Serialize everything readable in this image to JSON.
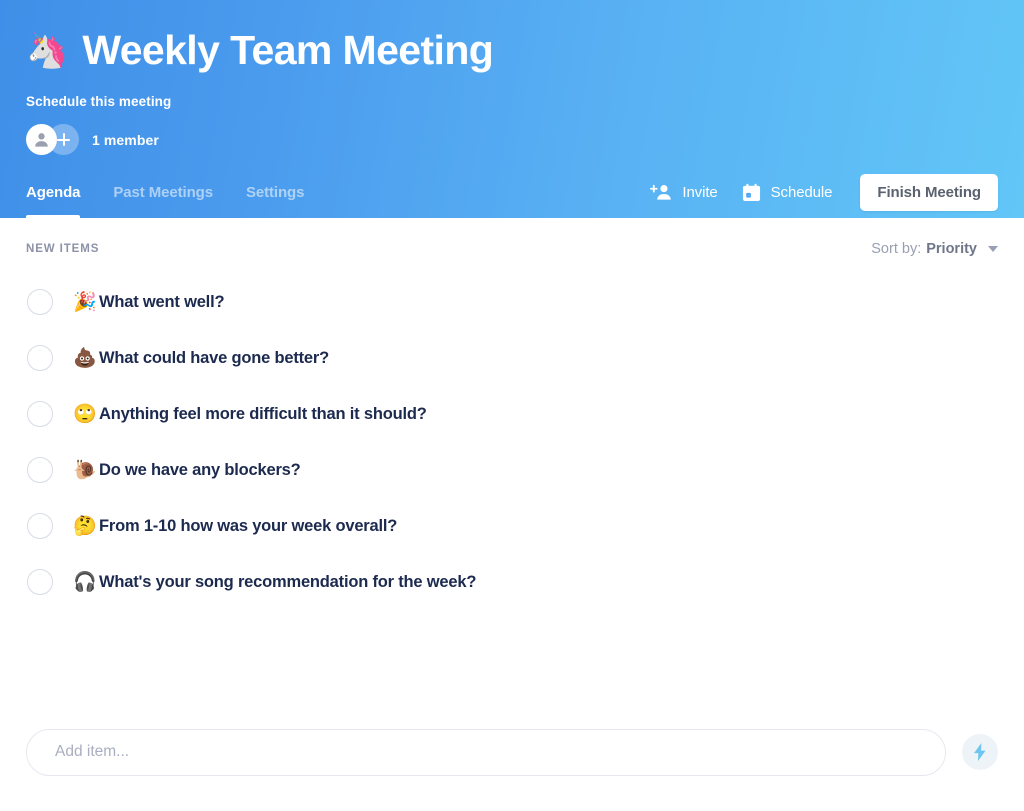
{
  "header": {
    "emoji": "🦄",
    "emoji_name": "unicorn-emoji",
    "title": "Weekly Team Meeting",
    "schedule_link": "Schedule this meeting",
    "member_count": "1 member",
    "gradient_from": "#3f8fe8",
    "gradient_to": "#62c6f7"
  },
  "nav": {
    "tabs": [
      {
        "label": "Agenda",
        "active": true
      },
      {
        "label": "Past Meetings",
        "active": false
      },
      {
        "label": "Settings",
        "active": false
      }
    ],
    "actions": [
      {
        "label": "Invite",
        "icon": "person-add-icon"
      },
      {
        "label": "Schedule",
        "icon": "calendar-icon"
      }
    ],
    "finish_button": "Finish Meeting"
  },
  "main": {
    "section_label": "NEW ITEMS",
    "sort": {
      "prefix": "Sort by:",
      "value": "Priority",
      "icon": "chevron-down-icon"
    },
    "items": [
      {
        "emoji": "🎉",
        "emoji_name": "party-popper-emoji",
        "text": "What went well?",
        "checked": false
      },
      {
        "emoji": "💩",
        "emoji_name": "pile-of-poo-emoji",
        "text": "What could have gone better?",
        "checked": false
      },
      {
        "emoji": "🙄",
        "emoji_name": "face-with-rolling-eyes-emoji",
        "text": "Anything feel more difficult than it should?",
        "checked": false
      },
      {
        "emoji": "🐌",
        "emoji_name": "snail-emoji",
        "text": "Do we have any blockers?",
        "checked": false
      },
      {
        "emoji": "🤔",
        "emoji_name": "thinking-face-emoji",
        "text": "From 1-10 how was your week overall?",
        "checked": false
      },
      {
        "emoji": "🎧",
        "emoji_name": "headphone-emoji",
        "text": "What's your song recommendation for the week?",
        "checked": false
      }
    ]
  },
  "composer": {
    "placeholder": "Add item...",
    "value": "",
    "bolt_icon": "lightning-bolt-icon",
    "bolt_color": "#6ec6ef"
  }
}
